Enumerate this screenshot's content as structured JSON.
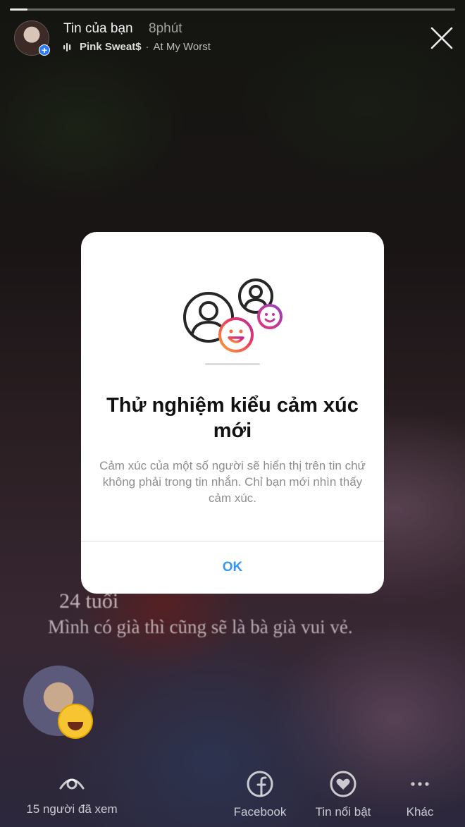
{
  "story": {
    "progress_fraction": 0.04,
    "title": "Tin của bạn",
    "time": "8phút",
    "music_artist": "Pink Sweat$",
    "music_separator": "·",
    "music_song": "At My Worst",
    "close_icon": "close-icon"
  },
  "overlay": {
    "line1": "24 tuổi",
    "line2": "Mình có già thì cũng sẽ là bà già vui vẻ."
  },
  "modal": {
    "title": "Thử nghiệm kiểu cảm xúc mới",
    "body": "Cảm xúc của một số người sẽ hiển thị trên tin chứ không phải trong tin nhắn. Chỉ bạn mới nhìn thấy cảm xúc.",
    "ok_label": "OK",
    "illustration_icon": "people-reaction-icon",
    "accent_color": "#3897f0"
  },
  "bottom_bar": {
    "viewers_label": "15 người đã xem",
    "facebook_label": "Facebook",
    "highlight_label": "Tin nổi bật",
    "more_label": "Khác"
  }
}
